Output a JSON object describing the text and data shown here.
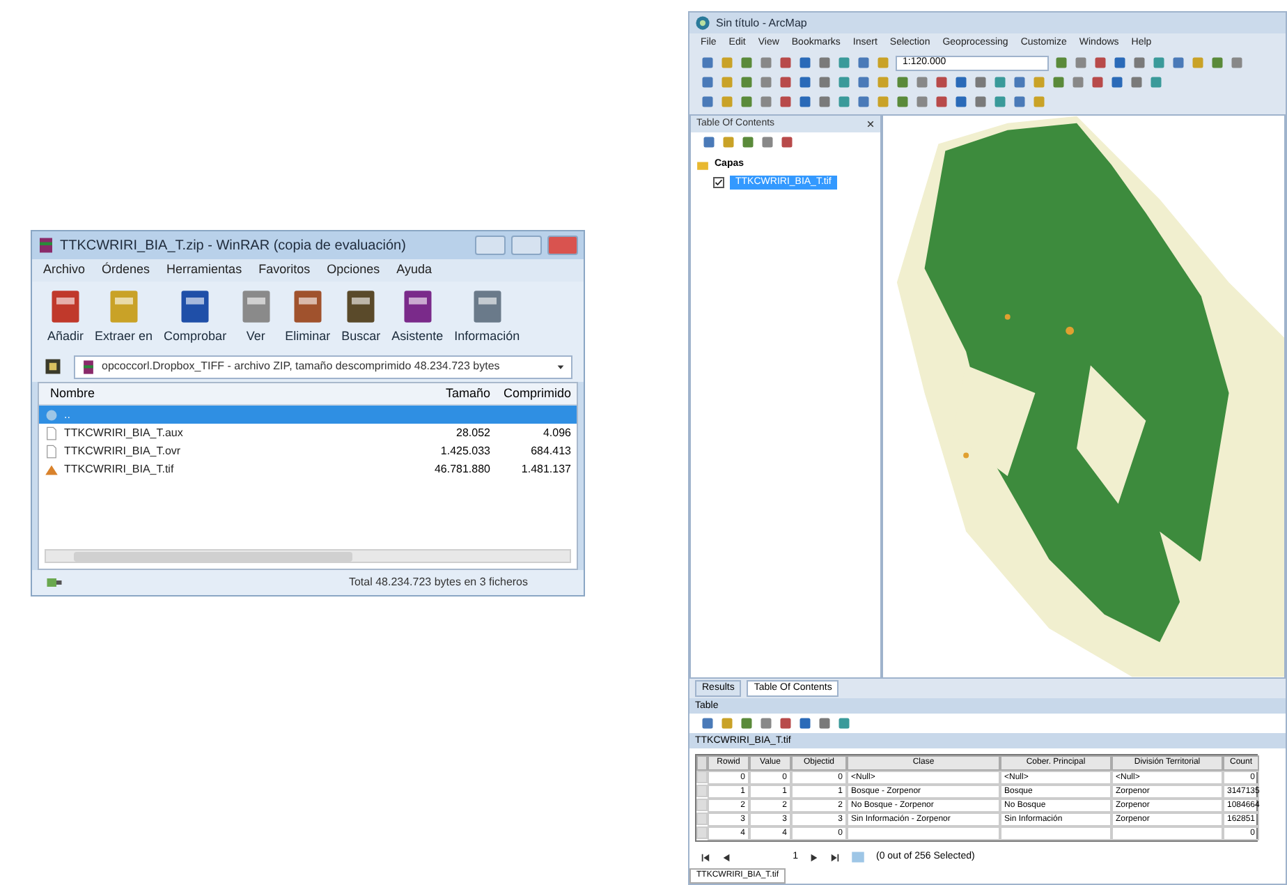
{
  "archive_window": {
    "title": "TTKCWRIRI_BIA_T.zip - WinRAR (copia de evaluación)",
    "menu": [
      "Archivo",
      "Órdenes",
      "Herramientas",
      "Favoritos",
      "Opciones",
      "Ayuda"
    ],
    "toolbar": [
      "Añadir",
      "Extraer en",
      "Comprobar",
      "Ver",
      "Eliminar",
      "Buscar",
      "Asistente",
      "Información"
    ],
    "path": "opcoccorl.Dropbox_TIFF - archivo ZIP, tamaño descomprimido 48.234.723 bytes",
    "columns": [
      "Nombre",
      "Tamaño",
      "Comprimido"
    ],
    "rows": [
      {
        "kind": "parent",
        "name": "..",
        "size": null,
        "packed": null,
        "selected": true
      },
      {
        "kind": "file",
        "name": "TTKCWRIRI_BIA_T.aux",
        "size": "28.052",
        "packed": "4.096",
        "selected": false
      },
      {
        "kind": "file",
        "name": "TTKCWRIRI_BIA_T.ovr",
        "size": "1.425.033",
        "packed": "684.413",
        "selected": false
      },
      {
        "kind": "image",
        "name": "TTKCWRIRI_BIA_T.tif",
        "size": "46.781.880",
        "packed": "1.481.137",
        "selected": false
      }
    ],
    "status": "Total 48.234.723 bytes en 3 ficheros"
  },
  "map_window": {
    "title": "Sin título - ArcMap",
    "menu": [
      "File",
      "Edit",
      "View",
      "Bookmarks",
      "Insert",
      "Selection",
      "Geoprocessing",
      "Customize",
      "Windows",
      "Help"
    ],
    "scale": "1:120.000",
    "toc": {
      "title": "Table Of Contents",
      "group": "Capas",
      "layer": {
        "name": "TTKCWRIRI_BIA_T.tif",
        "checked": true,
        "selected": true
      }
    },
    "dock_tabs": [
      {
        "label": "Results",
        "selected": false
      },
      {
        "label": "Table Of Contents",
        "selected": true
      }
    ],
    "table": {
      "title": "Table",
      "name": "TTKCWRIRI_BIA_T.tif",
      "columns": [
        "Rowid",
        "Value",
        "Objectid",
        "Clase",
        "Cober. Principal",
        "División Territorial",
        "Count"
      ],
      "rows": [
        [
          "0",
          "0",
          "0",
          "<Null>",
          "<Null>",
          "<Null>",
          "0"
        ],
        [
          "1",
          "1",
          "1",
          "Bosque - Zorpenor",
          "Bosque",
          "Zorpenor",
          "3147135"
        ],
        [
          "2",
          "2",
          "2",
          "No Bosque - Zorpenor",
          "No Bosque",
          "Zorpenor",
          "1084664"
        ],
        [
          "3",
          "3",
          "3",
          "Sin Información - Zorpenor",
          "Sin Información",
          "Zorpenor",
          "162851"
        ],
        [
          "4",
          "4",
          "0",
          null,
          null,
          null,
          "0"
        ]
      ],
      "record": "1",
      "selection": "(0 out of 256 Selected)",
      "bottom_tab": "TTKCWRIRI_BIA_T.tif"
    }
  }
}
